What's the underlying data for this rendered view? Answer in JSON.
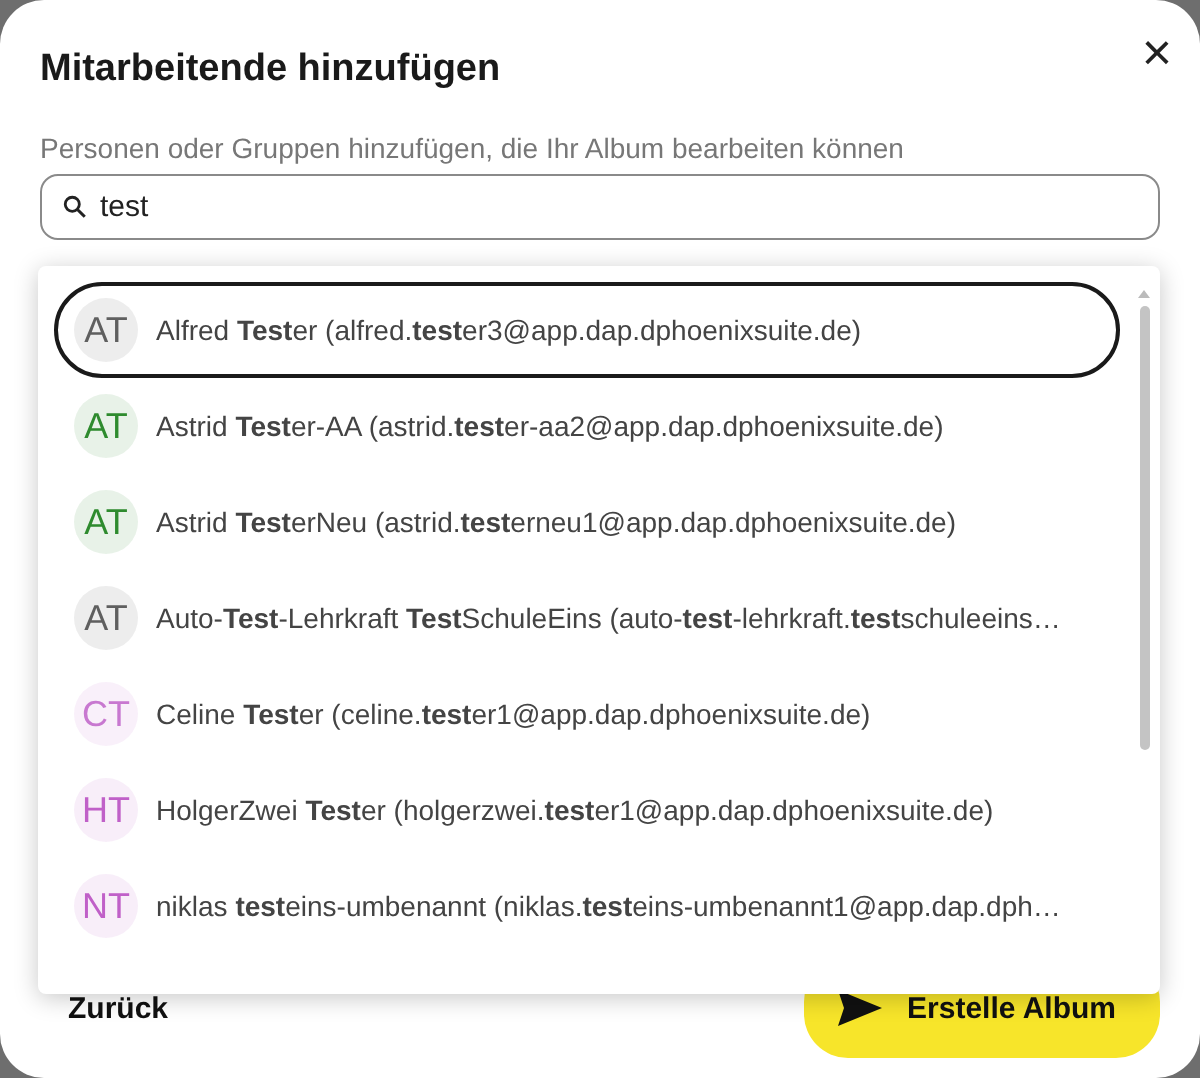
{
  "dialog": {
    "title": "Mitarbeitende hinzufügen",
    "close": "×",
    "subtitle": "Personen oder Gruppen hinzufügen, die Ihr Album bearbeiten können",
    "search": {
      "value": "test"
    },
    "suggestions": [
      {
        "initials": "AT",
        "color": "#5f5f5f",
        "label": "Alfred **Test**er (alfred.**test**er3@app.dap.dphoenixsuite.de)",
        "selected": true
      },
      {
        "initials": "AT",
        "color": "#2e8b2e",
        "label": "Astrid **Test**er-AA (astrid.**test**er-aa2@app.dap.dphoenixsuite.de)",
        "selected": false
      },
      {
        "initials": "AT",
        "color": "#2e8b2e",
        "label": "Astrid **Test**erNeu (astrid.**test**erneu1@app.dap.dphoenixsuite.de)",
        "selected": false
      },
      {
        "initials": "AT",
        "color": "#5f5f5f",
        "label": "Auto-**Test**-Lehrkraft **Test**SchuleEins (auto-**test**-lehrkraft.**test**schuleeins…",
        "selected": false
      },
      {
        "initials": "CT",
        "color": "#c878d0",
        "label": "Celine **Test**er (celine.**test**er1@app.dap.dphoenixsuite.de)",
        "selected": false
      },
      {
        "initials": "HT",
        "color": "#c060c8",
        "label": "HolgerZwei **Test**er (holgerzwei.**test**er1@app.dap.dphoenixsuite.de)",
        "selected": false
      },
      {
        "initials": "NT",
        "color": "#c060c8",
        "label": "niklas **test**eins-umbenannt (niklas.**test**eins-umbenannt1@app.dap.dph…",
        "selected": false
      }
    ],
    "buttons": [
      {
        "kind": "back",
        "label": "Zurück"
      },
      {
        "kind": "primary",
        "label": "Erstelle Album"
      }
    ]
  }
}
